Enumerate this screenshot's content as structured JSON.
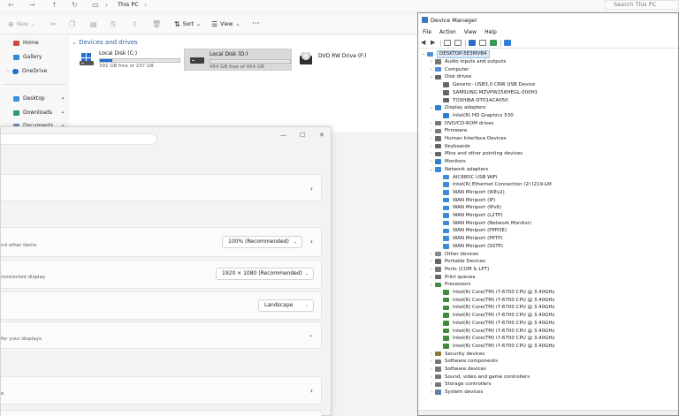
{
  "explorer": {
    "breadcrumb": "This PC",
    "search_placeholder": "Search This PC",
    "toolbar": {
      "new": "New",
      "sort": "Sort",
      "view": "View"
    },
    "nav": [
      {
        "label": "Home",
        "icon": "home-icon",
        "color": "#d04a3c"
      },
      {
        "label": "Gallery",
        "icon": "gallery-icon",
        "color": "#2e8ad8"
      },
      {
        "label": "OneDrive",
        "icon": "onedrive-icon",
        "color": "#1f6fd1"
      },
      {
        "label": "Desktop",
        "icon": "desktop-icon",
        "color": "#3b8fe0"
      },
      {
        "label": "Downloads",
        "icon": "downloads-icon",
        "color": "#2a9d6a"
      },
      {
        "label": "Documents",
        "icon": "documents-icon",
        "color": "#6a8fb5"
      }
    ],
    "section_title": "Devices and drives",
    "drives": [
      {
        "name": "Local Disk (C:)",
        "free": "391 GB free of 237 GB",
        "used_fraction": 0.16
      },
      {
        "name": "Local Disk (D:)",
        "free": "454 GB free of 454 GB",
        "used_fraction": 0.0
      },
      {
        "name": "DVD RW Drive (F:)",
        "free": ""
      }
    ]
  },
  "settings": {
    "rows": [
      {
        "text": "",
        "has_chevron": true
      },
      {
        "text": "nd other items",
        "dropdown": "100% (Recommended)",
        "has_chevron": true
      },
      {
        "text": "connected display",
        "dropdown": "1920 × 1080 (Recommended)"
      },
      {
        "text": "",
        "dropdown": "Landscape"
      },
      {
        "text": "for your displays",
        "has_expand": true
      },
      {
        "text": "e",
        "has_chevron": true
      }
    ]
  },
  "device_manager": {
    "title": "Device Manager",
    "menu": [
      "File",
      "Action",
      "View",
      "Help"
    ],
    "tree": [
      {
        "label": "DESKTOP-5E3MVB4",
        "level": 0,
        "expand": "v",
        "icon": "computer-icon",
        "root": true
      },
      {
        "label": "Audio inputs and outputs",
        "level": 1,
        "expand": ">",
        "icon": "audio-icon"
      },
      {
        "label": "Computer",
        "level": 1,
        "expand": ">",
        "icon": "computer-icon"
      },
      {
        "label": "Disk drives",
        "level": 1,
        "expand": "v",
        "icon": "disk-icon"
      },
      {
        "label": "Generic- USB3.0 CRW USB Device",
        "level": 2,
        "icon": "disk-icon"
      },
      {
        "label": "SAMSUNG MZVPW256HEGL-000H1",
        "level": 2,
        "icon": "disk-icon"
      },
      {
        "label": "TOSHIBA DT01ACA050",
        "level": 2,
        "icon": "disk-icon"
      },
      {
        "label": "Display adapters",
        "level": 1,
        "expand": "v",
        "icon": "display-icon"
      },
      {
        "label": "Intel(R) HD Graphics 530",
        "level": 2,
        "icon": "display-icon"
      },
      {
        "label": "DVD/CD-ROM drives",
        "level": 1,
        "expand": ">",
        "icon": "dvd-icon"
      },
      {
        "label": "Firmware",
        "level": 1,
        "expand": ">",
        "icon": "firmware-icon"
      },
      {
        "label": "Human Interface Devices",
        "level": 1,
        "expand": ">",
        "icon": "hid-icon"
      },
      {
        "label": "Keyboards",
        "level": 1,
        "expand": ">",
        "icon": "keyboard-icon"
      },
      {
        "label": "Mice and other pointing devices",
        "level": 1,
        "expand": ">",
        "icon": "mouse-icon"
      },
      {
        "label": "Monitors",
        "level": 1,
        "expand": ">",
        "icon": "monitor-icon"
      },
      {
        "label": "Network adapters",
        "level": 1,
        "expand": "v",
        "icon": "network-icon"
      },
      {
        "label": "AIC88DC USB WiFi",
        "level": 2,
        "icon": "network-icon"
      },
      {
        "label": "Intel(R) Ethernet Connection (2) I219-LM",
        "level": 2,
        "icon": "network-icon"
      },
      {
        "label": "WAN Miniport (IKEv2)",
        "level": 2,
        "icon": "network-icon"
      },
      {
        "label": "WAN Miniport (IP)",
        "level": 2,
        "icon": "network-icon"
      },
      {
        "label": "WAN Miniport (IPv6)",
        "level": 2,
        "icon": "network-icon"
      },
      {
        "label": "WAN Miniport (L2TP)",
        "level": 2,
        "icon": "network-icon"
      },
      {
        "label": "WAN Miniport (Network Monitor)",
        "level": 2,
        "icon": "network-icon"
      },
      {
        "label": "WAN Miniport (PPPOE)",
        "level": 2,
        "icon": "network-icon"
      },
      {
        "label": "WAN Miniport (PPTP)",
        "level": 2,
        "icon": "network-icon"
      },
      {
        "label": "WAN Miniport (SSTP)",
        "level": 2,
        "icon": "network-icon"
      },
      {
        "label": "Other devices",
        "level": 1,
        "expand": ">",
        "icon": "other-icon"
      },
      {
        "label": "Portable Devices",
        "level": 1,
        "expand": ">",
        "icon": "portable-icon"
      },
      {
        "label": "Ports (COM & LPT)",
        "level": 1,
        "expand": ">",
        "icon": "port-icon"
      },
      {
        "label": "Print queues",
        "level": 1,
        "expand": ">",
        "icon": "printer-icon"
      },
      {
        "label": "Processors",
        "level": 1,
        "expand": "v",
        "icon": "cpu-icon"
      },
      {
        "label": "Intel(R) Core(TM) i7-6700 CPU @ 3.40GHz",
        "level": 2,
        "icon": "cpu-icon"
      },
      {
        "label": "Intel(R) Core(TM) i7-6700 CPU @ 3.40GHz",
        "level": 2,
        "icon": "cpu-icon"
      },
      {
        "label": "Intel(R) Core(TM) i7-6700 CPU @ 3.40GHz",
        "level": 2,
        "icon": "cpu-icon"
      },
      {
        "label": "Intel(R) Core(TM) i7-6700 CPU @ 3.40GHz",
        "level": 2,
        "icon": "cpu-icon"
      },
      {
        "label": "Intel(R) Core(TM) i7-6700 CPU @ 3.40GHz",
        "level": 2,
        "icon": "cpu-icon"
      },
      {
        "label": "Intel(R) Core(TM) i7-6700 CPU @ 3.40GHz",
        "level": 2,
        "icon": "cpu-icon"
      },
      {
        "label": "Intel(R) Core(TM) i7-6700 CPU @ 3.40GHz",
        "level": 2,
        "icon": "cpu-icon"
      },
      {
        "label": "Intel(R) Core(TM) i7-6700 CPU @ 3.40GHz",
        "level": 2,
        "icon": "cpu-icon"
      },
      {
        "label": "Security devices",
        "level": 1,
        "expand": ">",
        "icon": "security-icon"
      },
      {
        "label": "Software components",
        "level": 1,
        "expand": ">",
        "icon": "software-icon"
      },
      {
        "label": "Software devices",
        "level": 1,
        "expand": ">",
        "icon": "software-icon"
      },
      {
        "label": "Sound, video and game controllers",
        "level": 1,
        "expand": ">",
        "icon": "sound-icon"
      },
      {
        "label": "Storage controllers",
        "level": 1,
        "expand": ">",
        "icon": "storage-icon"
      },
      {
        "label": "System devices",
        "level": 1,
        "expand": ">",
        "icon": "system-icon"
      }
    ]
  }
}
